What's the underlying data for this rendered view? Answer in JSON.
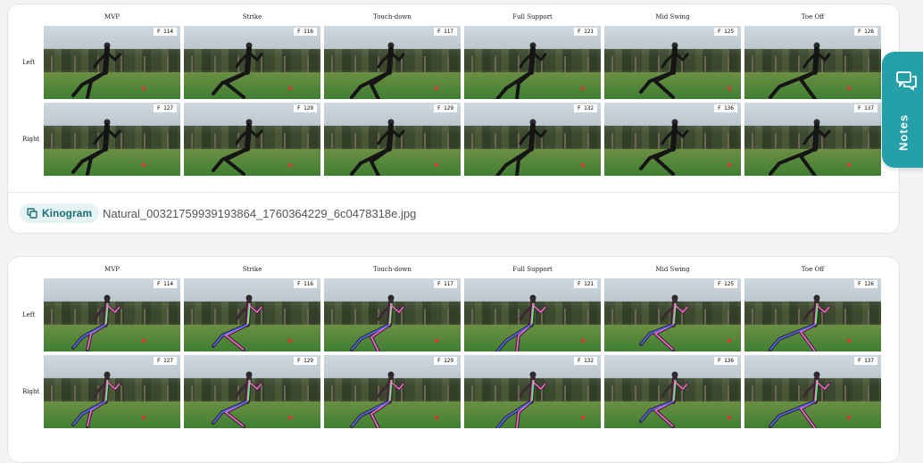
{
  "phases": [
    "MVP",
    "Strike",
    "Touch-down",
    "Full Support",
    "Mid Swing",
    "Toe Off"
  ],
  "rows": [
    {
      "label": "Left",
      "frames": [
        "F 114",
        "F 116",
        "F 117",
        "F 121",
        "F 125",
        "F 126"
      ]
    },
    {
      "label": "Right",
      "frames": [
        "F 127",
        "F 129",
        "F 129",
        "F 132",
        "F 136",
        "F 137"
      ]
    }
  ],
  "result_card": {
    "badge_label": "Kinogram",
    "filename": "Natural_00321759939193864_1760364229_6c0478318e.jpg"
  },
  "notes_tab": {
    "label": "Notes"
  },
  "colors": {
    "accent": "#25a0a8",
    "badge_bg": "#e6f3f4",
    "badge_text": "#1b6e74"
  }
}
